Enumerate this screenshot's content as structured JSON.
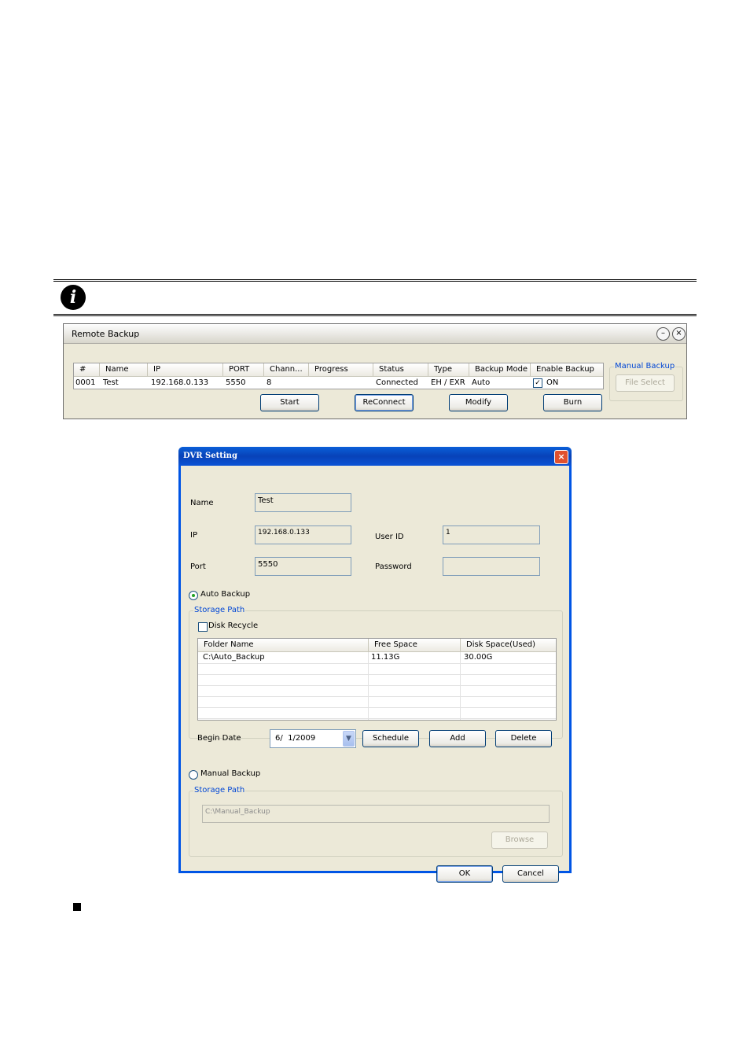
{
  "note": {
    "icon": "info-icon"
  },
  "remote_backup": {
    "title": "Remote Backup",
    "columns": [
      "#",
      "Name",
      "IP",
      "PORT",
      "Chann...",
      "Progress",
      "Status",
      "Type",
      "Backup Mode",
      "Enable Backup"
    ],
    "row": {
      "num": "0001",
      "name": "Test",
      "ip": "192.168.0.133",
      "port": "5550",
      "channels": "8",
      "progress": "",
      "status": "Connected",
      "type": "EH / EXR",
      "backup_mode": "Auto",
      "enable_backup_checked": true,
      "enable_backup": "ON"
    },
    "buttons": {
      "start": "Start",
      "reconnect": "ReConnect",
      "modify": "Modify",
      "burn": "Burn"
    },
    "manual_backup_group": "Manual Backup",
    "file_select": "File Select",
    "window_icons": [
      "minimize-icon",
      "close-icon"
    ]
  },
  "dvr_setting": {
    "title": "DVR Setting",
    "name_label": "Name",
    "name_value": "Test",
    "ip_label": "IP",
    "ip_value": "192.168.0.133",
    "user_id_label": "User ID",
    "user_id_value": "1",
    "port_label": "Port",
    "port_value": "5550",
    "password_label": "Password",
    "password_value": "",
    "auto_backup_label": "Auto Backup",
    "auto_backup_selected": true,
    "storage_path_label": "Storage Path",
    "disk_recycle_label": "Disk Recycle",
    "disk_recycle_checked": false,
    "table": {
      "columns": [
        "Folder Name",
        "Free Space",
        "Disk Space(Used)"
      ],
      "rows": [
        {
          "folder": "C:\\Auto_Backup",
          "free": "11.13G",
          "used": "30.00G"
        }
      ]
    },
    "begin_date_label": "Begin Date",
    "begin_date_value": "6/  1/2009",
    "schedule": "Schedule",
    "add": "Add",
    "delete": "Delete",
    "manual_backup_label": "Manual Backup",
    "manual_backup_selected": false,
    "manual_storage_path_label": "Storage Path",
    "manual_path_value": "C:\\Manual_Backup",
    "browse": "Browse",
    "ok": "OK",
    "cancel": "Cancel"
  },
  "colors": {
    "xp_face": "#ece9d8",
    "title_blue": "#0055e5",
    "group_label": "#0046d5"
  }
}
